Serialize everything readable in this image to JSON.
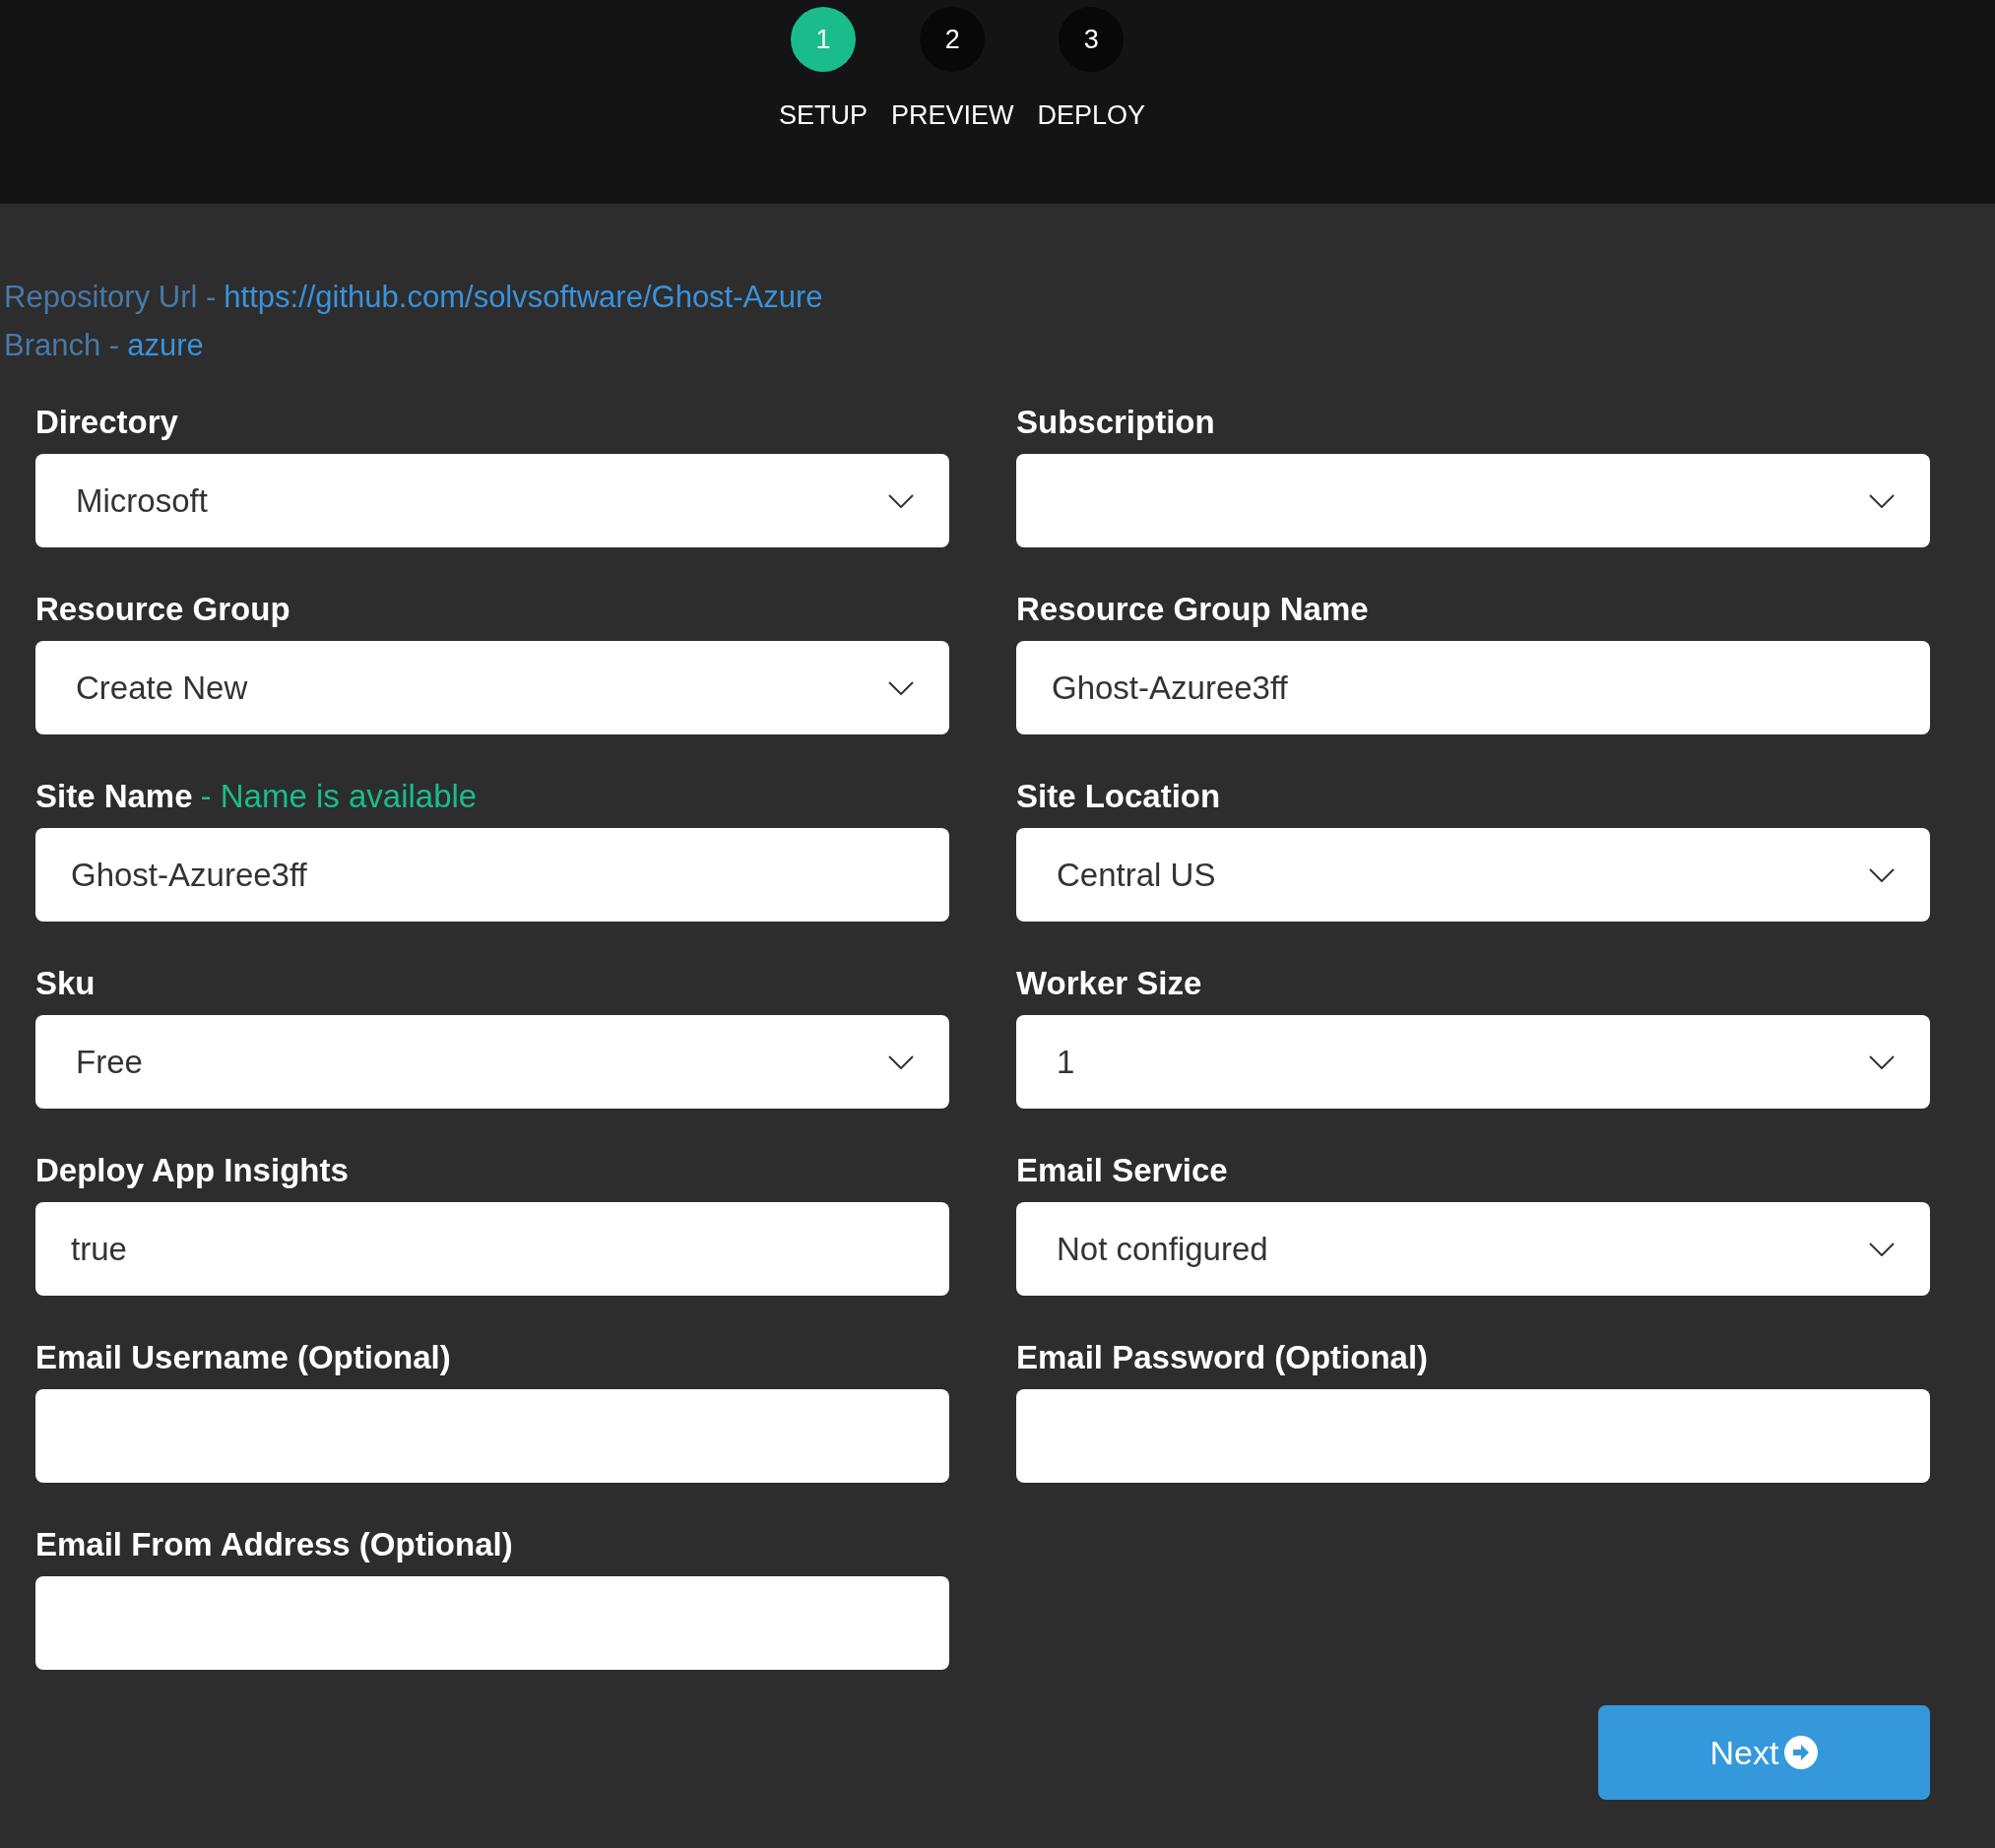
{
  "steps": [
    {
      "number": "1",
      "label": "SETUP",
      "selected": true
    },
    {
      "number": "2",
      "label": "PREVIEW",
      "selected": false
    },
    {
      "number": "3",
      "label": "DEPLOY",
      "selected": false
    }
  ],
  "source": [
    {
      "label": "Repository Url -",
      "link": "https://github.com/solvsoftware/Ghost-Azure"
    },
    {
      "label": "Branch -",
      "link": "azure"
    }
  ],
  "fields": [
    {
      "label": "Directory",
      "kind": "select",
      "value": "Microsoft"
    },
    {
      "label": "Subscription",
      "kind": "select"
    },
    {
      "label": "Resource Group",
      "kind": "select",
      "value": "Create New"
    },
    {
      "label": "Resource Group Name",
      "kind": "text",
      "value": "Ghost-Azuree3ff"
    },
    {
      "label": "Site Name",
      "kind": "text",
      "value": "Ghost-Azuree3ff",
      "note": "- Name is available"
    },
    {
      "label": "Site Location",
      "kind": "select",
      "value": "Central US"
    },
    {
      "label": "Sku",
      "kind": "select",
      "value": "Free"
    },
    {
      "label": "Worker Size",
      "kind": "select",
      "value": "1"
    },
    {
      "label": "Deploy App Insights",
      "kind": "text",
      "value": "true"
    },
    {
      "label": "Email Service",
      "kind": "select",
      "value": "Not configured"
    },
    {
      "label": "Email Username (Optional)",
      "kind": "text"
    },
    {
      "label": "Email Password (Optional)",
      "kind": "text"
    },
    {
      "label": "Email From Address (Optional)",
      "kind": "text"
    }
  ],
  "next_button": {
    "label": "Next"
  }
}
